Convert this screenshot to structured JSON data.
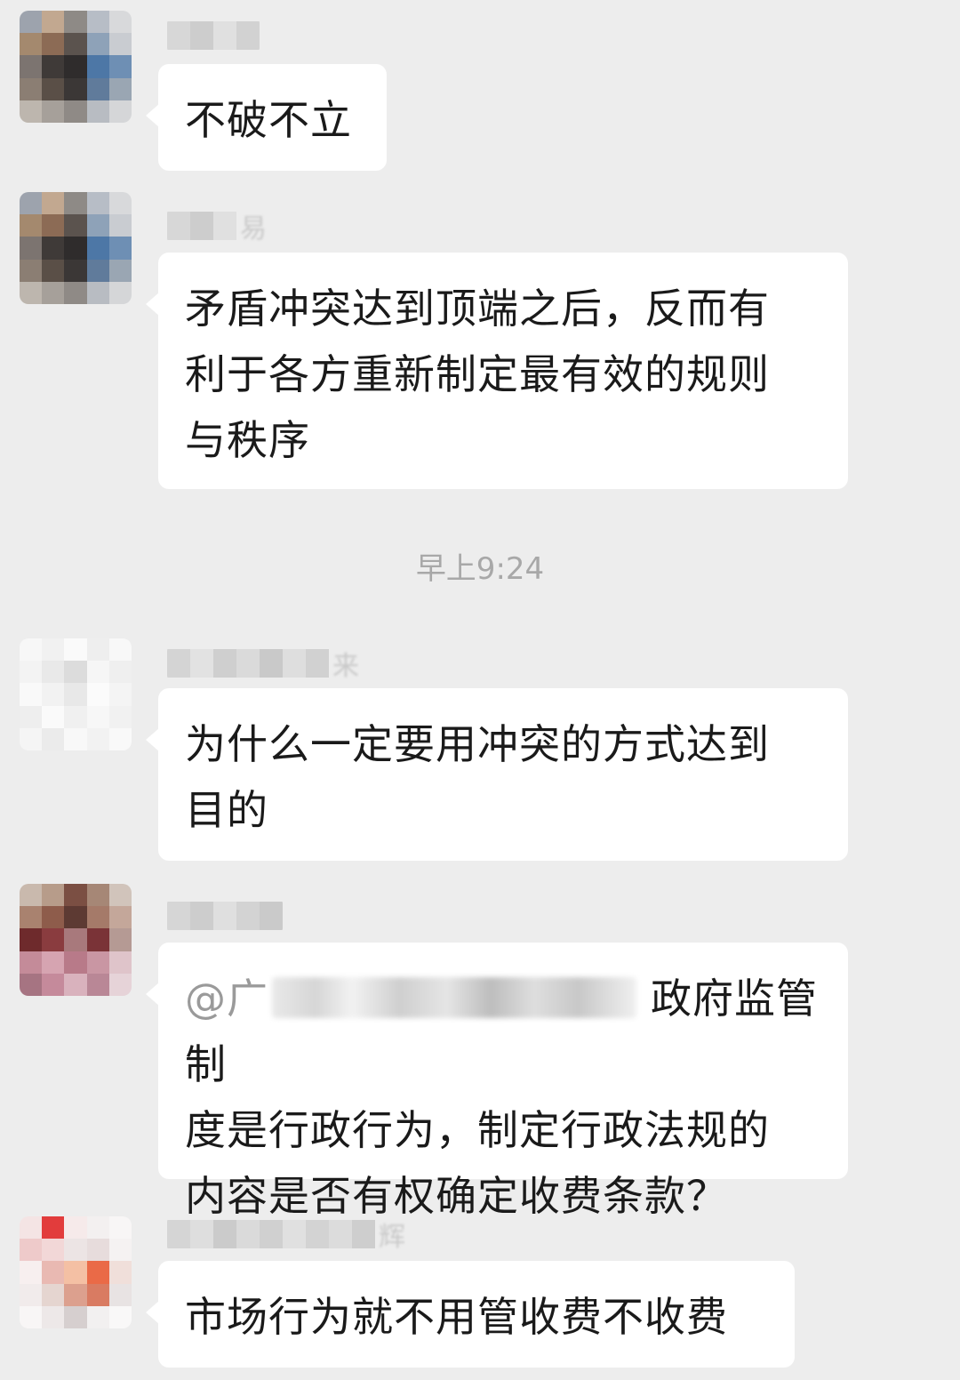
{
  "conversation": {
    "timestamp": "早上9:24",
    "messages": [
      {
        "sender_suffix": "",
        "lines": [
          "不破不立"
        ]
      },
      {
        "sender_suffix": "易",
        "lines": [
          "矛盾冲突达到顶端之后，反而有",
          "利于各方重新制定最有效的规则",
          "与秩序"
        ]
      },
      {
        "sender_suffix": "来",
        "lines": [
          "为什么一定要用冲突的方式达到",
          "目的"
        ]
      },
      {
        "sender_suffix": "",
        "mention_prefix": "@广",
        "lines": [
          "政府监管制",
          "度是行政行为，制定行政法规的",
          "内容是否有权确定收费条款？"
        ]
      },
      {
        "sender_suffix": "辉",
        "lines": [
          "市场行为就不用管收费不收费"
        ]
      }
    ]
  },
  "colors": {
    "background": "#ededed",
    "bubble": "#ffffff",
    "text": "#1a1a1a",
    "timestamp": "#a8a8a8"
  }
}
